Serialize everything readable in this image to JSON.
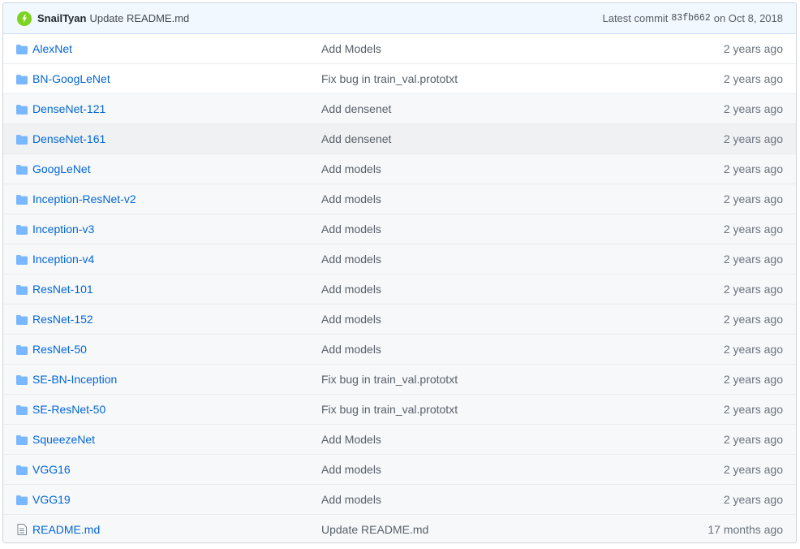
{
  "latest_commit": {
    "author": "SnailTyan",
    "message": "Update README.md",
    "prefix": "Latest commit",
    "sha": "83fb662",
    "date_text": "on Oct 8, 2018",
    "avatar_color": "#7ed321"
  },
  "files": [
    {
      "name": "AlexNet",
      "type": "folder",
      "message": "Add Models",
      "age": "2 years ago"
    },
    {
      "name": "BN-GoogLeNet",
      "type": "folder",
      "message": "Fix bug in train_val.prototxt",
      "age": "2 years ago"
    },
    {
      "name": "DenseNet-121",
      "type": "folder",
      "message": "Add densenet",
      "age": "2 years ago"
    },
    {
      "name": "DenseNet-161",
      "type": "folder",
      "message": "Add densenet",
      "age": "2 years ago"
    },
    {
      "name": "GoogLeNet",
      "type": "folder",
      "message": "Add models",
      "age": "2 years ago"
    },
    {
      "name": "Inception-ResNet-v2",
      "type": "folder",
      "message": "Add models",
      "age": "2 years ago"
    },
    {
      "name": "Inception-v3",
      "type": "folder",
      "message": "Add models",
      "age": "2 years ago"
    },
    {
      "name": "Inception-v4",
      "type": "folder",
      "message": "Add models",
      "age": "2 years ago"
    },
    {
      "name": "ResNet-101",
      "type": "folder",
      "message": "Add models",
      "age": "2 years ago"
    },
    {
      "name": "ResNet-152",
      "type": "folder",
      "message": "Add models",
      "age": "2 years ago"
    },
    {
      "name": "ResNet-50",
      "type": "folder",
      "message": "Add models",
      "age": "2 years ago"
    },
    {
      "name": "SE-BN-Inception",
      "type": "folder",
      "message": "Fix bug in train_val.prototxt",
      "age": "2 years ago"
    },
    {
      "name": "SE-ResNet-50",
      "type": "folder",
      "message": "Fix bug in train_val.prototxt",
      "age": "2 years ago"
    },
    {
      "name": "SqueezeNet",
      "type": "folder",
      "message": "Add Models",
      "age": "2 years ago"
    },
    {
      "name": "VGG16",
      "type": "folder",
      "message": "Add models",
      "age": "2 years ago"
    },
    {
      "name": "VGG19",
      "type": "folder",
      "message": "Add models",
      "age": "2 years ago"
    },
    {
      "name": "README.md",
      "type": "file",
      "message": "Update README.md",
      "age": "17 months ago"
    }
  ],
  "icons": {
    "folder": "folder-icon",
    "file": "file-icon"
  },
  "colors": {
    "link": "#0366d6",
    "folder_icon": "#79b8ff",
    "header_bg": "#f1f8ff"
  }
}
